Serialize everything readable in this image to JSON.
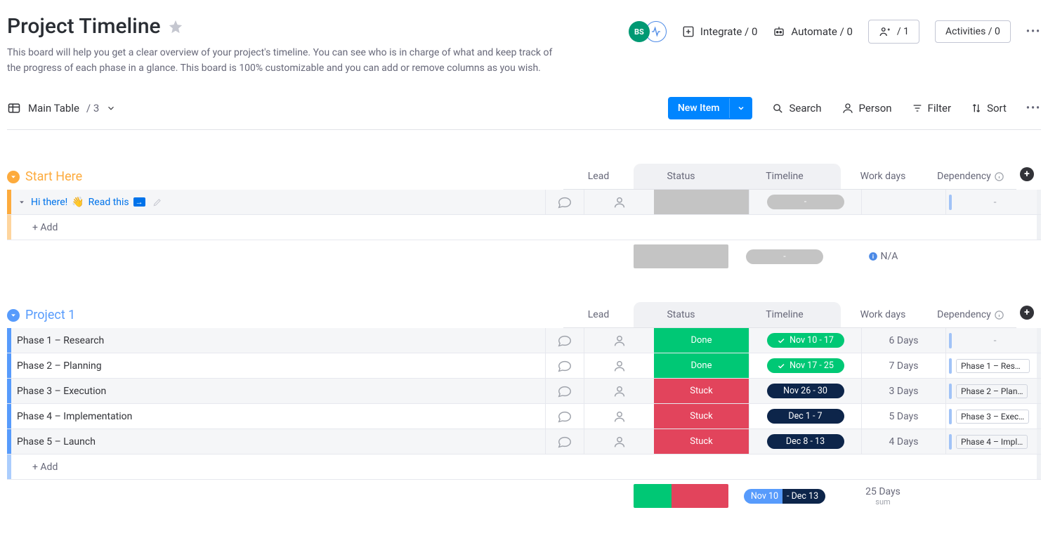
{
  "header": {
    "title": "Project Timeline",
    "description": "This board will help you get a clear overview of your project's timeline. You can see who is in charge of what and keep track of the progress of each phase in a glance. This board is 100% customizable and you can add or remove columns as you wish.",
    "avatar_initials": "BS",
    "integrate_label": "Integrate / 0",
    "automate_label": "Automate / 0",
    "members_label": "/ 1",
    "activities_label": "Activities / 0"
  },
  "toolbar": {
    "view_name": "Main Table",
    "view_count": "/ 3",
    "new_item": "New Item",
    "search": "Search",
    "person": "Person",
    "filter": "Filter",
    "sort": "Sort"
  },
  "columns": {
    "lead": "Lead",
    "status": "Status",
    "timeline": "Timeline",
    "workdays": "Work days",
    "dependency": "Dependency"
  },
  "groups": [
    {
      "name": "Start Here",
      "color": "#fdab3d",
      "title_color": "#fdab3d",
      "rows": [
        {
          "name_pre": "Hi there! ",
          "name_link": "Read this",
          "link_style": true,
          "wave": true,
          "arrow_badge": true,
          "pencil": true,
          "expand_caret": true,
          "status_class": "status-gray",
          "status_text": "",
          "timeline_class": "pill-gray",
          "timeline_text": "-",
          "timeline_check": false,
          "workdays": "",
          "dependency": "-",
          "dep_pill": false
        }
      ],
      "add_label": "+ Add",
      "summary": {
        "status_segments": [
          {
            "color": "#c4c4c4",
            "frac": 1
          }
        ],
        "timeline": {
          "text": "-",
          "bg": "pill-gray",
          "split": false
        },
        "workdays": "N/A",
        "workdays_info": true
      }
    },
    {
      "name": "Project 1",
      "color": "#579bfc",
      "title_color": "#579bfc",
      "rows": [
        {
          "name": "Phase 1 – Research",
          "status_class": "status-done",
          "status_text": "Done",
          "timeline_class": "pill-green",
          "timeline_text": "Nov 10 - 17",
          "timeline_check": true,
          "workdays": "6 Days",
          "dependency": "-",
          "dep_pill": false
        },
        {
          "name": "Phase 2 – Planning",
          "status_class": "status-done",
          "status_text": "Done",
          "timeline_class": "pill-green",
          "timeline_text": "Nov 17 - 25",
          "timeline_check": true,
          "workdays": "7 Days",
          "dependency": "Phase 1 – Rese…",
          "dep_pill": true
        },
        {
          "name": "Phase 3 – Execution",
          "status_class": "status-stuck",
          "status_text": "Stuck",
          "timeline_class": "pill-navy",
          "timeline_text": "Nov 26 - 30",
          "timeline_check": false,
          "workdays": "3 Days",
          "dependency": "Phase 2 – Plan…",
          "dep_pill": true
        },
        {
          "name": "Phase 4 – Implementation",
          "status_class": "status-stuck",
          "status_text": "Stuck",
          "timeline_class": "pill-navy",
          "timeline_text": "Dec 1 - 7",
          "timeline_check": false,
          "workdays": "5 Days",
          "dependency": "Phase 3 – Exec…",
          "dep_pill": true
        },
        {
          "name": "Phase 5 – Launch",
          "status_class": "status-stuck",
          "status_text": "Stuck",
          "timeline_class": "pill-navy",
          "timeline_text": "Dec 8 - 13",
          "timeline_check": false,
          "workdays": "4 Days",
          "dependency": "Phase 4 – Impl…",
          "dep_pill": true
        }
      ],
      "add_label": "+ Add",
      "summary": {
        "status_segments": [
          {
            "color": "#00c875",
            "frac": 0.4
          },
          {
            "color": "#e2445c",
            "frac": 0.6
          }
        ],
        "timeline": {
          "split": true,
          "left_text": "Nov 10",
          "right_text": "- Dec 13",
          "left_bg": "#579bfc",
          "right_bg": "#0d254a"
        },
        "workdays": "25 Days",
        "sum_label": "sum"
      }
    }
  ]
}
